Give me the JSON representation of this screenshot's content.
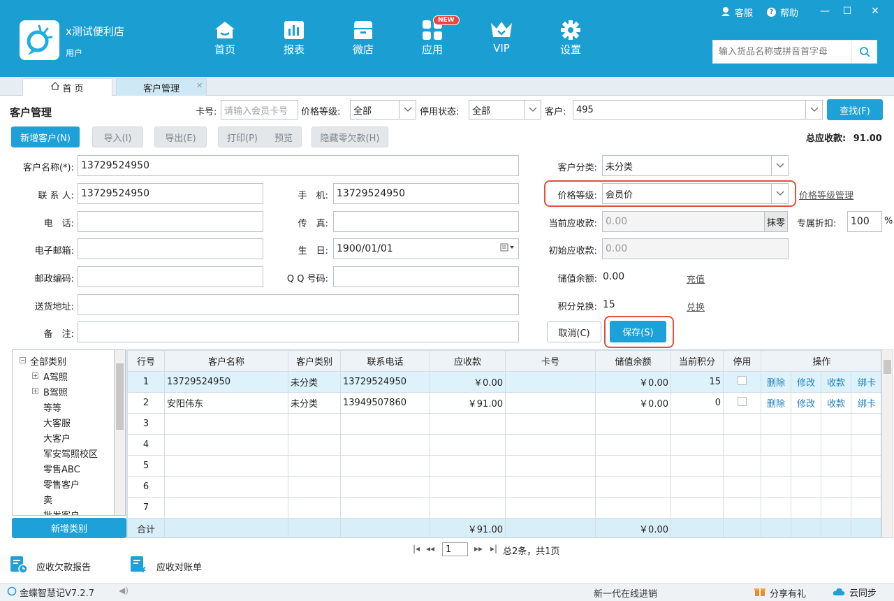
{
  "header": {
    "shop_name": "x测试便利店",
    "user_label": "用户",
    "nav": [
      {
        "label": "首页",
        "icon": "home-icon"
      },
      {
        "label": "报表",
        "icon": "report-icon"
      },
      {
        "label": "微店",
        "icon": "shop-icon"
      },
      {
        "label": "应用",
        "icon": "apps-icon"
      },
      {
        "label": "VIP",
        "icon": "vip-icon"
      },
      {
        "label": "设置",
        "icon": "gear-icon"
      }
    ],
    "new_badge": "NEW",
    "service": "客服",
    "help": "帮助",
    "search_placeholder": "输入货品名称或拼音首字母"
  },
  "tabs": {
    "home": "首 页",
    "customer": "客户管理"
  },
  "filter": {
    "title": "客户管理",
    "card_label": "卡号:",
    "card_placeholder": "请输入会员卡号",
    "price_level_label": "价格等级:",
    "price_level_value": "全部",
    "disable_label": "停用状态:",
    "disable_value": "全部",
    "customer_label": "客户:",
    "customer_value": "495",
    "find": "查找(F)"
  },
  "toolbar": {
    "add": "新增客户(N)",
    "import": "导入(I)",
    "export": "导出(E)",
    "print": "打印(P)",
    "preview": "预览",
    "hide_zero": "隐藏零欠款(H)",
    "total_label": "总应收款:",
    "total_value": "91.00"
  },
  "form": {
    "name_label": "客户名称(*):",
    "name_value": "13729524950",
    "contact_label": "联 系 人:",
    "contact_value": "13729524950",
    "mobile_label": "手　机:",
    "mobile_value": "13729524950",
    "phone_label": "电　话:",
    "phone_value": "",
    "fax_label": "传　真:",
    "fax_value": "",
    "email_label": "电子邮箱:",
    "email_value": "",
    "birthday_label": "生　日:",
    "birthday_value": "1900/01/01",
    "zip_label": "邮政编码:",
    "zip_value": "",
    "qq_label": "Q Q 号码:",
    "qq_value": "",
    "address_label": "送货地址:",
    "address_value": "",
    "remark_label": "备　注:",
    "remark_value": "",
    "category_label": "客户分类:",
    "category_value": "未分类",
    "price_level_label": "价格等级:",
    "price_level_value": "会员价",
    "price_level_manage": "价格等级管理",
    "current_receivable_label": "当前应收款:",
    "current_receivable_value": "0.00",
    "round_off": "抹零",
    "discount_label": "专属折扣:",
    "discount_value": "100",
    "discount_unit": "%",
    "initial_receivable_label": "初始应收款:",
    "initial_receivable_value": "0.00",
    "balance_label": "储值余额:",
    "balance_value": "0.00",
    "recharge": "充值",
    "points_label": "积分兑换:",
    "points_value": "15",
    "exchange": "兑换",
    "cancel": "取消(C)",
    "save": "保存(S)"
  },
  "tree": {
    "root": "全部类别",
    "items": [
      "A驾照",
      "B驾照",
      "等等",
      "大客服",
      "大客户",
      "军安驾照校区",
      "零售ABC",
      "零售客户",
      "卖",
      "批发客户"
    ],
    "add_category": "新增类别"
  },
  "table": {
    "headers": [
      "行号",
      "客户名称",
      "客户类别",
      "联系电话",
      "应收款",
      "卡号",
      "储值余额",
      "当前积分",
      "停用",
      "操作"
    ],
    "rows": [
      {
        "no": "1",
        "name": "13729524950",
        "category": "未分类",
        "phone": "13729524950",
        "receivable": "￥0.00",
        "card": "",
        "balance": "￥0.00",
        "points": "15"
      },
      {
        "no": "2",
        "name": "安阳伟东",
        "category": "未分类",
        "phone": "13949507860",
        "receivable": "￥91.00",
        "card": "",
        "balance": "￥0.00",
        "points": "0"
      },
      {
        "no": "3"
      },
      {
        "no": "4"
      },
      {
        "no": "5"
      },
      {
        "no": "6"
      },
      {
        "no": "7"
      }
    ],
    "ops": [
      "删除",
      "修改",
      "收款",
      "绑卡"
    ],
    "total_label": "合计",
    "total_receivable": "￥91.00",
    "total_balance": "￥0.00"
  },
  "pager": {
    "current": "1",
    "summary": "总2条，共1页"
  },
  "bottom": {
    "report": "应收欠款报告",
    "statement": "应收对账单"
  },
  "status": {
    "version": "金蝶智慧记V7.2.7",
    "slogan": "新一代在线进销",
    "share": "分享有礼",
    "sync": "云同步"
  }
}
